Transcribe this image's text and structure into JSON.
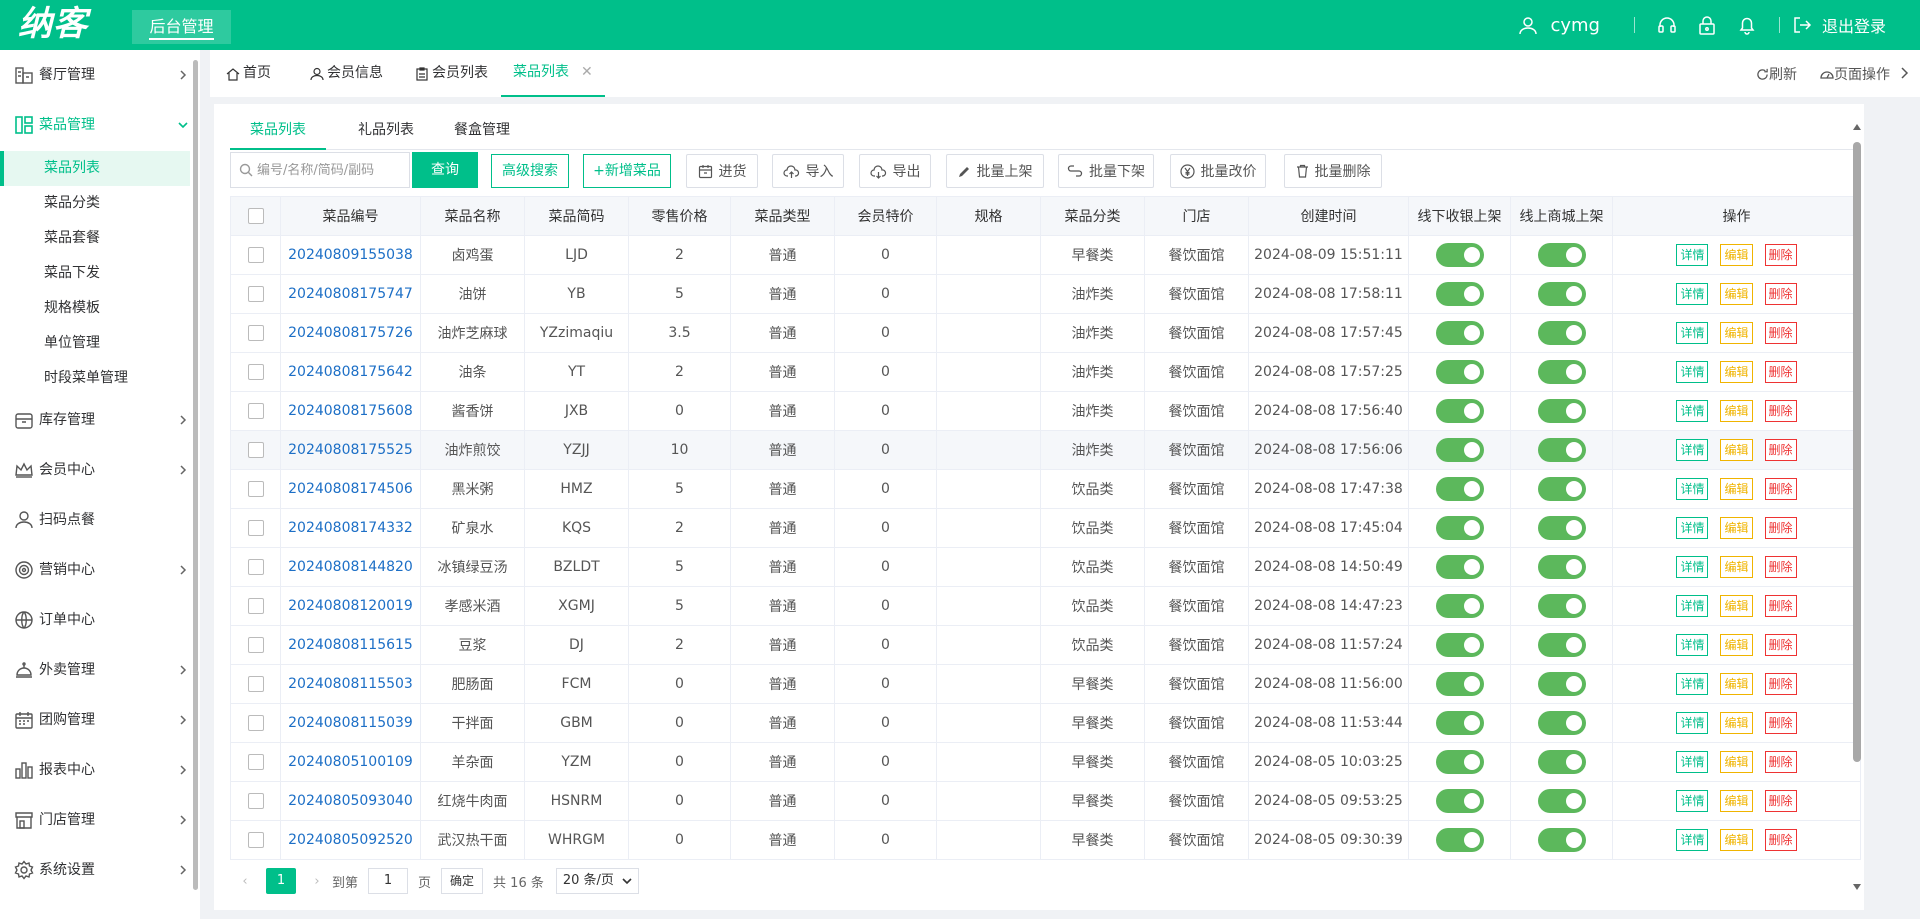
{
  "header": {
    "logo": "纳客",
    "system_title": "后台管理",
    "username": "cymg",
    "logout_label": "退出登录",
    "brand_color": "#00bf8a"
  },
  "sidebar": {
    "menus": [
      {
        "label": "餐厅管理",
        "icon": "store-icon"
      },
      {
        "label": "菜品管理",
        "icon": "dashboard-icon",
        "expanded": true
      },
      {
        "label": "库存管理",
        "icon": "inventory-box-icon"
      },
      {
        "label": "会员中心",
        "icon": "crown-icon"
      },
      {
        "label": "扫码点餐",
        "icon": "user-icon"
      },
      {
        "label": "营销中心",
        "icon": "target-icon"
      },
      {
        "label": "订单中心",
        "icon": "globe-icon"
      },
      {
        "label": "外卖管理",
        "icon": "delivery-icon"
      },
      {
        "label": "团购管理",
        "icon": "calendar-icon"
      },
      {
        "label": "报表中心",
        "icon": "bar-chart-icon"
      },
      {
        "label": "门店管理",
        "icon": "shop-icon"
      },
      {
        "label": "系统设置",
        "icon": "gear-icon"
      }
    ],
    "submenu": [
      "菜品列表",
      "菜品分类",
      "菜品套餐",
      "菜品下发",
      "规格模板",
      "单位管理",
      "时段菜单管理"
    ]
  },
  "tabs": {
    "items": [
      "首页",
      "会员信息",
      "会员列表",
      "菜品列表"
    ],
    "refresh": "刷新",
    "page_ops": "页面操作"
  },
  "subtabs": [
    "菜品列表",
    "礼品列表",
    "餐盒管理"
  ],
  "toolbar": {
    "search_placeholder": "编号/名称/简码/副码",
    "query": "查询",
    "advanced": "高级搜索",
    "add": "+新增菜品",
    "stock_in": "进货",
    "import": "导入",
    "export": "导出",
    "batch_on": "批量上架",
    "batch_off": "批量下架",
    "batch_price": "批量改价",
    "batch_delete": "批量删除"
  },
  "table": {
    "columns": [
      "菜品编号",
      "菜品名称",
      "菜品简码",
      "零售价格",
      "菜品类型",
      "会员特价",
      "规格",
      "菜品分类",
      "门店",
      "创建时间",
      "线下收银上架",
      "线上商城上架",
      "操作"
    ],
    "actions": {
      "detail": "详情",
      "edit": "编辑",
      "delete": "删除"
    },
    "rows": [
      {
        "code": "20240809155038",
        "name": "卤鸡蛋",
        "abbr": "LJD",
        "price": "2",
        "type": "普通",
        "member_price": "0",
        "spec": "",
        "category": "早餐类",
        "store": "餐饮面馆",
        "created": "2024-08-09 15:51:11",
        "offline_on": true,
        "online_on": true
      },
      {
        "code": "20240808175747",
        "name": "油饼",
        "abbr": "YB",
        "price": "5",
        "type": "普通",
        "member_price": "0",
        "spec": "",
        "category": "油炸类",
        "store": "餐饮面馆",
        "created": "2024-08-08 17:58:11",
        "offline_on": true,
        "online_on": true
      },
      {
        "code": "20240808175726",
        "name": "油炸芝麻球",
        "abbr": "YZzimaqiu",
        "price": "3.5",
        "type": "普通",
        "member_price": "0",
        "spec": "",
        "category": "油炸类",
        "store": "餐饮面馆",
        "created": "2024-08-08 17:57:45",
        "offline_on": true,
        "online_on": true
      },
      {
        "code": "20240808175642",
        "name": "油条",
        "abbr": "YT",
        "price": "2",
        "type": "普通",
        "member_price": "0",
        "spec": "",
        "category": "油炸类",
        "store": "餐饮面馆",
        "created": "2024-08-08 17:57:25",
        "offline_on": true,
        "online_on": true
      },
      {
        "code": "20240808175608",
        "name": "酱香饼",
        "abbr": "JXB",
        "price": "0",
        "type": "普通",
        "member_price": "0",
        "spec": "",
        "category": "油炸类",
        "store": "餐饮面馆",
        "created": "2024-08-08 17:56:40",
        "offline_on": true,
        "online_on": true
      },
      {
        "code": "20240808175525",
        "name": "油炸煎饺",
        "abbr": "YZJJ",
        "price": "10",
        "type": "普通",
        "member_price": "0",
        "spec": "",
        "category": "油炸类",
        "store": "餐饮面馆",
        "created": "2024-08-08 17:56:06",
        "offline_on": true,
        "online_on": true
      },
      {
        "code": "20240808174506",
        "name": "黑米粥",
        "abbr": "HMZ",
        "price": "5",
        "type": "普通",
        "member_price": "0",
        "spec": "",
        "category": "饮品类",
        "store": "餐饮面馆",
        "created": "2024-08-08 17:47:38",
        "offline_on": true,
        "online_on": true
      },
      {
        "code": "20240808174332",
        "name": "矿泉水",
        "abbr": "KQS",
        "price": "2",
        "type": "普通",
        "member_price": "0",
        "spec": "",
        "category": "饮品类",
        "store": "餐饮面馆",
        "created": "2024-08-08 17:45:04",
        "offline_on": true,
        "online_on": true
      },
      {
        "code": "20240808144820",
        "name": "冰镇绿豆汤",
        "abbr": "BZLDT",
        "price": "5",
        "type": "普通",
        "member_price": "0",
        "spec": "",
        "category": "饮品类",
        "store": "餐饮面馆",
        "created": "2024-08-08 14:50:49",
        "offline_on": true,
        "online_on": true
      },
      {
        "code": "20240808120019",
        "name": "孝感米酒",
        "abbr": "XGMJ",
        "price": "5",
        "type": "普通",
        "member_price": "0",
        "spec": "",
        "category": "饮品类",
        "store": "餐饮面馆",
        "created": "2024-08-08 14:47:23",
        "offline_on": true,
        "online_on": true
      },
      {
        "code": "20240808115615",
        "name": "豆浆",
        "abbr": "DJ",
        "price": "2",
        "type": "普通",
        "member_price": "0",
        "spec": "",
        "category": "饮品类",
        "store": "餐饮面馆",
        "created": "2024-08-08 11:57:24",
        "offline_on": true,
        "online_on": true
      },
      {
        "code": "20240808115503",
        "name": "肥肠面",
        "abbr": "FCM",
        "price": "0",
        "type": "普通",
        "member_price": "0",
        "spec": "",
        "category": "早餐类",
        "store": "餐饮面馆",
        "created": "2024-08-08 11:56:00",
        "offline_on": true,
        "online_on": true
      },
      {
        "code": "20240808115039",
        "name": "干拌面",
        "abbr": "GBM",
        "price": "0",
        "type": "普通",
        "member_price": "0",
        "spec": "",
        "category": "早餐类",
        "store": "餐饮面馆",
        "created": "2024-08-08 11:53:44",
        "offline_on": true,
        "online_on": true
      },
      {
        "code": "20240805100109",
        "name": "羊杂面",
        "abbr": "YZM",
        "price": "0",
        "type": "普通",
        "member_price": "0",
        "spec": "",
        "category": "早餐类",
        "store": "餐饮面馆",
        "created": "2024-08-05 10:03:25",
        "offline_on": true,
        "online_on": true
      },
      {
        "code": "20240805093040",
        "name": "红烧牛肉面",
        "abbr": "HSNRM",
        "price": "0",
        "type": "普通",
        "member_price": "0",
        "spec": "",
        "category": "早餐类",
        "store": "餐饮面馆",
        "created": "2024-08-05 09:53:25",
        "offline_on": true,
        "online_on": true
      },
      {
        "code": "20240805092520",
        "name": "武汉热干面",
        "abbr": "WHRGM",
        "price": "0",
        "type": "普通",
        "member_price": "0",
        "spec": "",
        "category": "早餐类",
        "store": "餐饮面馆",
        "created": "2024-08-05 09:30:39",
        "offline_on": true,
        "online_on": true
      }
    ]
  },
  "pagination": {
    "current": "1",
    "goto_label": "到第",
    "page_input": "1",
    "page_suffix": "页",
    "confirm": "确定",
    "total": "共 16 条",
    "page_size": "20 条/页"
  }
}
